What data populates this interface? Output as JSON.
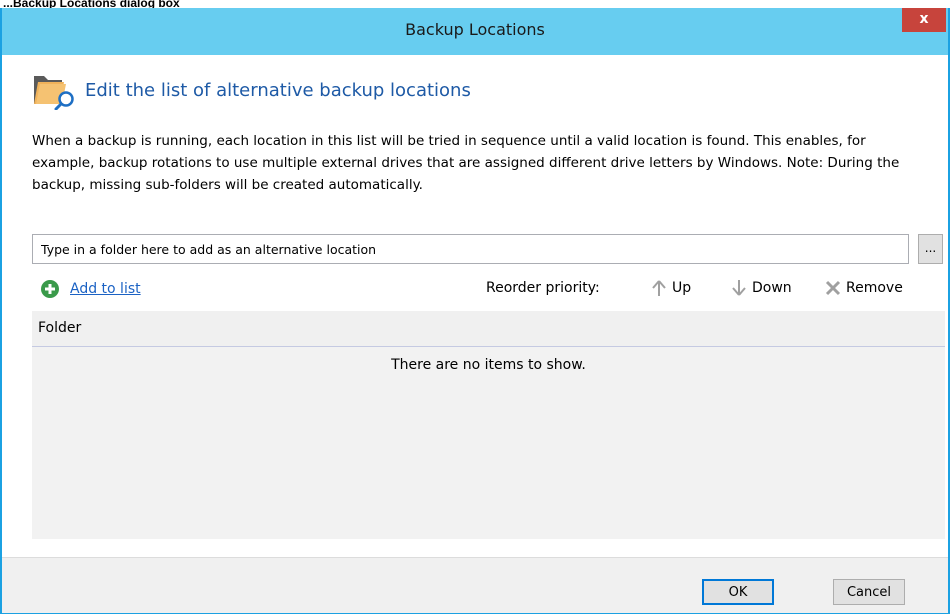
{
  "caption": "...Backup Locations dialog box",
  "window": {
    "title": "Backup Locations",
    "close_glyph": "x",
    "accent": "#1ba1e2",
    "titlebar_color": "#67cdf0"
  },
  "header": {
    "icon": "folder-search-icon",
    "heading": "Edit the list of alternative backup locations"
  },
  "description": "When a backup is running, each location in this list will be tried in sequence until a valid location is found. This enables, for example, backup rotations to use multiple external drives that are assigned different drive letters by Windows.   Note: During the backup, missing sub-folders will be created automatically.",
  "path_input": {
    "placeholder": "Type in a folder here to add as an alternative location",
    "value": ""
  },
  "browse_button": {
    "label": "..."
  },
  "toolbar": {
    "add_label": "Add to list",
    "reorder_label": "Reorder priority:",
    "up_label": "Up",
    "down_label": "Down",
    "remove_label": "Remove"
  },
  "list": {
    "columns": [
      "Folder"
    ],
    "rows": [],
    "empty_message": "There are no items to show."
  },
  "buttons": {
    "ok": "OK",
    "cancel": "Cancel"
  }
}
